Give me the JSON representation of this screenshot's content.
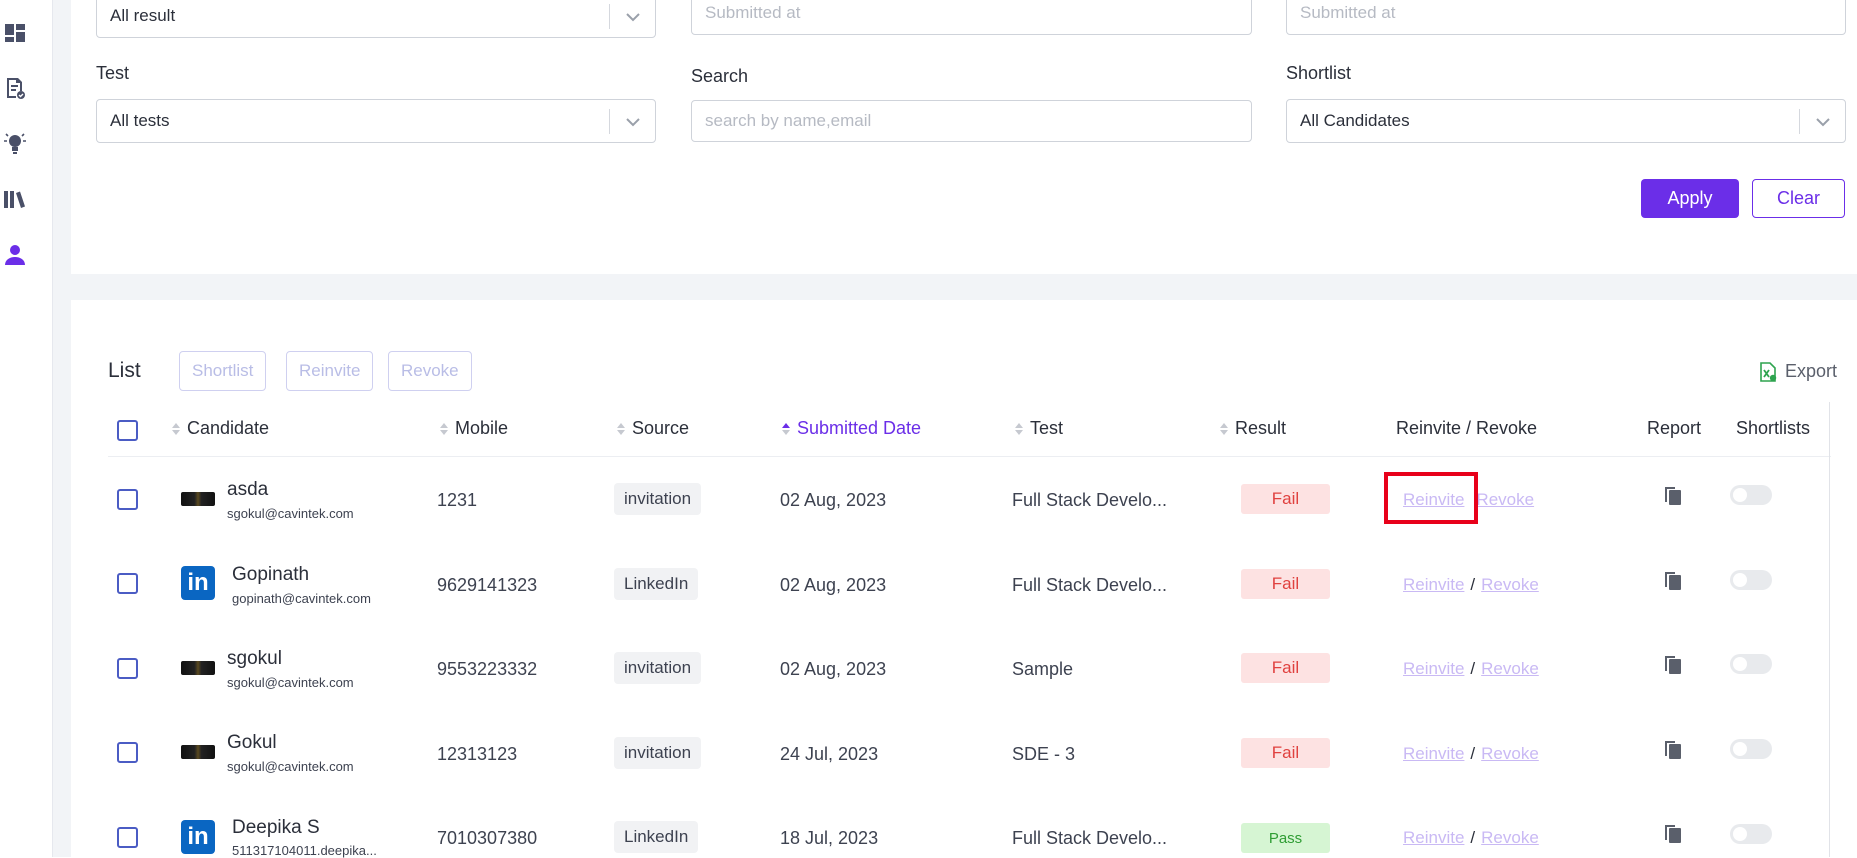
{
  "sidebar": {
    "items": [
      {
        "icon": "dashboard-icon"
      },
      {
        "icon": "document-check-icon"
      },
      {
        "icon": "lightbulb-icon"
      },
      {
        "icon": "library-icon"
      },
      {
        "icon": "user-icon"
      }
    ]
  },
  "filters": {
    "result_value": "All result",
    "submitted_from_placeholder": "Submitted at",
    "submitted_to_placeholder": "Submitted at",
    "test_label": "Test",
    "test_value": "All tests",
    "search_label": "Search",
    "search_placeholder": "search by name,email",
    "shortlist_label": "Shortlist",
    "shortlist_value": "All Candidates",
    "apply_label": "Apply",
    "clear_label": "Clear"
  },
  "list": {
    "title": "List",
    "bulk_shortlist": "Shortlist",
    "bulk_reinvite": "Reinvite",
    "bulk_revoke": "Revoke",
    "export_label": "Export",
    "columns": {
      "candidate": "Candidate",
      "mobile": "Mobile",
      "source": "Source",
      "submitted_date": "Submitted Date",
      "test": "Test",
      "result": "Result",
      "reinvite_revoke": "Reinvite / Revoke",
      "report": "Report",
      "shortlists": "Shortlists"
    },
    "reinvite_link": "Reinvite",
    "revoke_link": "Revoke",
    "slash": "/",
    "rows": [
      {
        "name": "asda",
        "email": "sgokul@cavintek.com",
        "avatar": "dark",
        "mobile": "1231",
        "source": "invitation",
        "date": "02 Aug, 2023",
        "test": "Full Stack Develo...",
        "result": "Fail",
        "result_type": "fail",
        "slash": ""
      },
      {
        "name": "Gopinath",
        "email": "gopinath@cavintek.com",
        "avatar": "linkedin",
        "mobile": "9629141323",
        "source": "LinkedIn",
        "date": "02 Aug, 2023",
        "test": "Full Stack Develo...",
        "result": "Fail",
        "result_type": "fail",
        "slash": "/"
      },
      {
        "name": "sgokul",
        "email": "sgokul@cavintek.com",
        "avatar": "dark",
        "mobile": "9553223332",
        "source": "invitation",
        "date": "02 Aug, 2023",
        "test": "Sample",
        "result": "Fail",
        "result_type": "fail",
        "slash": "/"
      },
      {
        "name": "Gokul",
        "email": "sgokul@cavintek.com",
        "avatar": "dark",
        "mobile": "12313123",
        "source": "invitation",
        "date": "24 Jul, 2023",
        "test": "SDE - 3",
        "result": "Fail",
        "result_type": "fail",
        "slash": "/"
      },
      {
        "name": "Deepika S",
        "email": "511317104011.deepika...",
        "avatar": "linkedin",
        "mobile": "7010307380",
        "source": "LinkedIn",
        "date": "18 Jul, 2023",
        "test": "Full Stack Develo...",
        "result": "Pass",
        "result_type": "pass",
        "slash": "/"
      }
    ]
  },
  "colors": {
    "accent": "#6b2ee8",
    "fail_bg": "#fde2e2",
    "fail_text": "#e0413f",
    "pass_bg": "#d6f5d3",
    "pass_text": "#2f9d34",
    "highlight": "#e8001a"
  }
}
